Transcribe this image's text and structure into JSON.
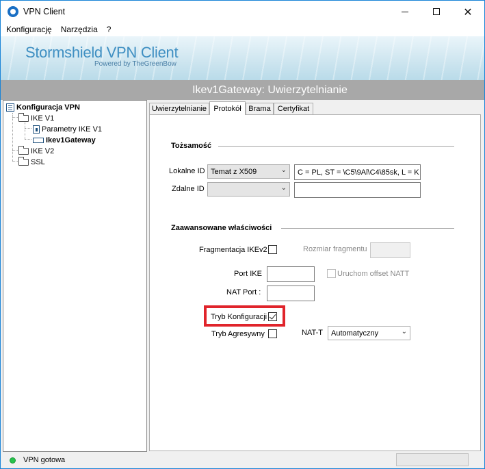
{
  "window": {
    "title": "VPN Client"
  },
  "menu": {
    "items": [
      "Konfigurację",
      "Narzędzia",
      "?"
    ]
  },
  "banner": {
    "title": "Stormshield VPN Client",
    "subtitle": "Powered by TheGreenBow"
  },
  "header": {
    "title": "Ikev1Gateway: Uwierzytelnianie"
  },
  "tree": {
    "root": "Konfiguracja VPN",
    "ikev1": "IKE V1",
    "params": "Parametry IKE V1",
    "gateway": "Ikev1Gateway",
    "ikev2": "IKE V2",
    "ssl": "SSL"
  },
  "tabs": [
    "Uwierzytelnianie",
    "Protokół",
    "Brama",
    "Certyfikat"
  ],
  "identity": {
    "title": "Tożsamość",
    "local_label": "Lokalne ID",
    "local_type": "Temat z X509",
    "local_value": "C = PL, ST = \\C5\\9Al\\C4\\85sk, L = K",
    "remote_label": "Zdalne ID",
    "remote_type": "",
    "remote_value": ""
  },
  "advanced": {
    "title": "Zaawansowane właściwości",
    "frag_label": "Fragmentacja IKEv2",
    "frag_checked": false,
    "frag_size_label": "Rozmiar fragmentu",
    "frag_size_value": "",
    "port_ike_label": "Port IKE",
    "port_ike_value": "",
    "nat_offset_label": "Uruchom offset NATT",
    "nat_port_label": "NAT Port :",
    "nat_port_value": "",
    "config_mode_label": "Tryb Konfiguracji",
    "config_mode_checked": true,
    "aggressive_label": "Tryb Agresywny",
    "aggressive_checked": false,
    "natt_label": "NAT-T",
    "natt_value": "Automatyczny"
  },
  "status": {
    "text": "VPN gotowa",
    "color": "#27c24c"
  },
  "colors": {
    "highlight": "#e0242b",
    "header_bg": "#a8a8a8",
    "brand": "#3f8fc2"
  }
}
